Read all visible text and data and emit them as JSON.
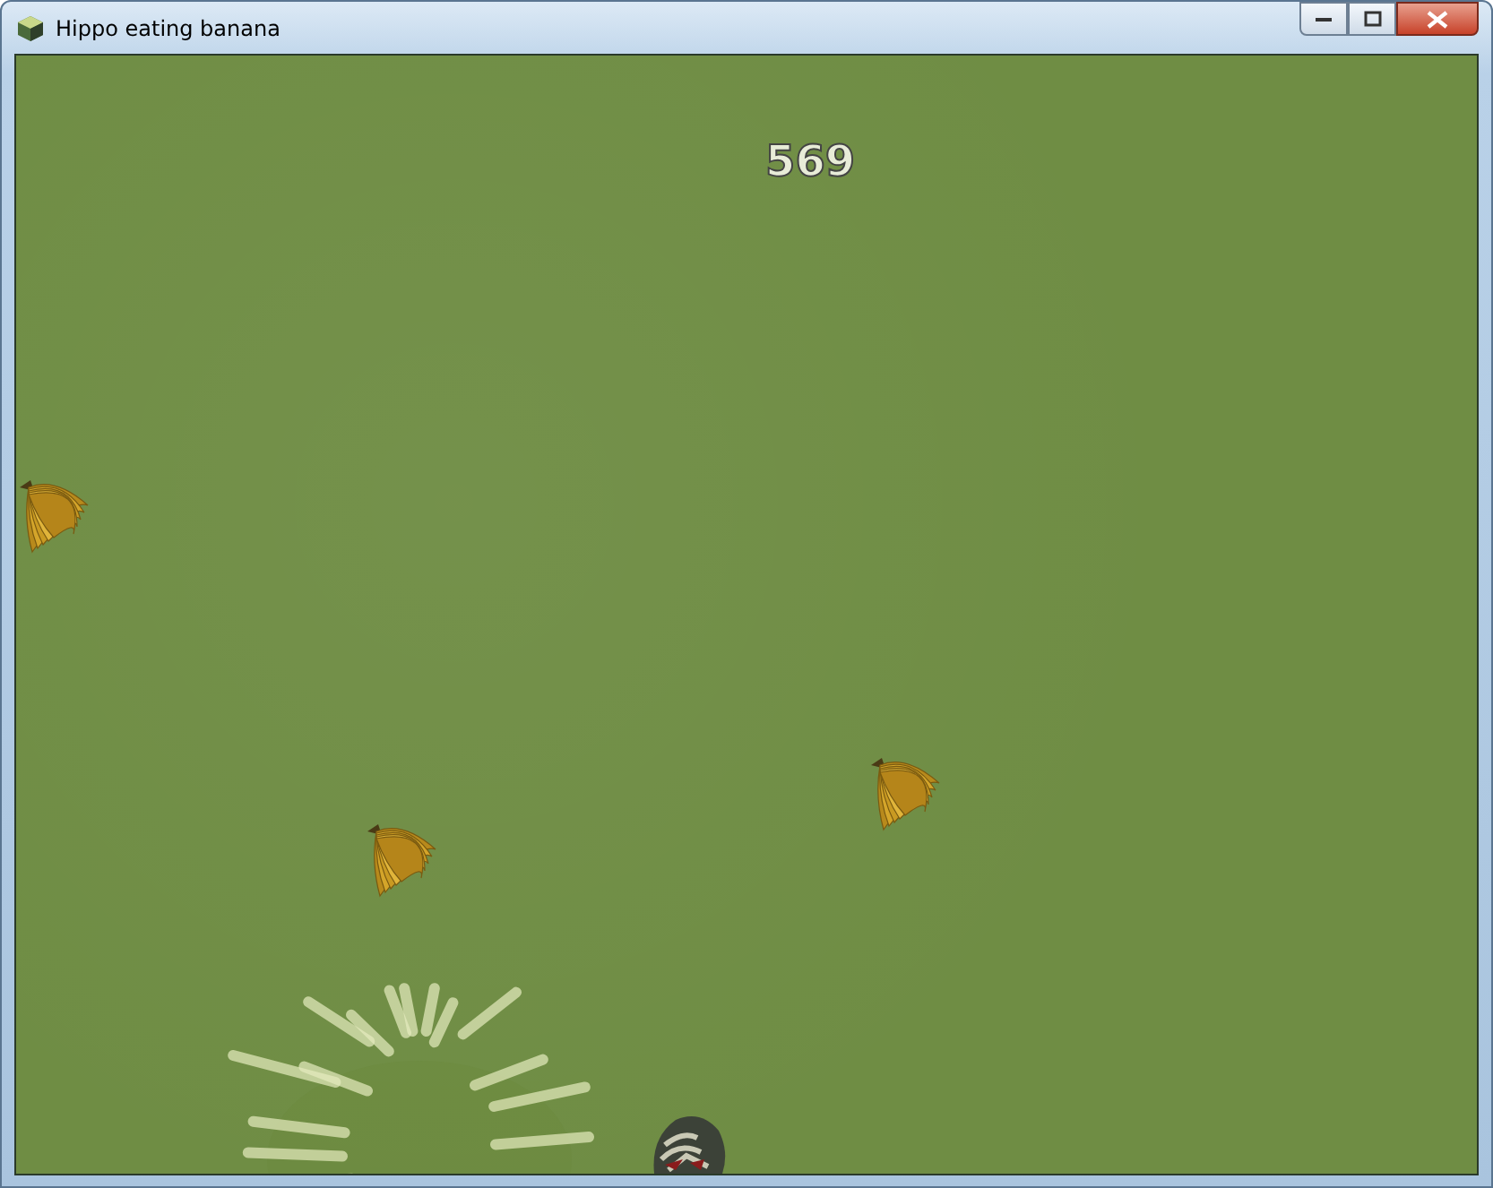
{
  "window": {
    "title": "Hippo eating banana"
  },
  "game": {
    "score": "569"
  }
}
